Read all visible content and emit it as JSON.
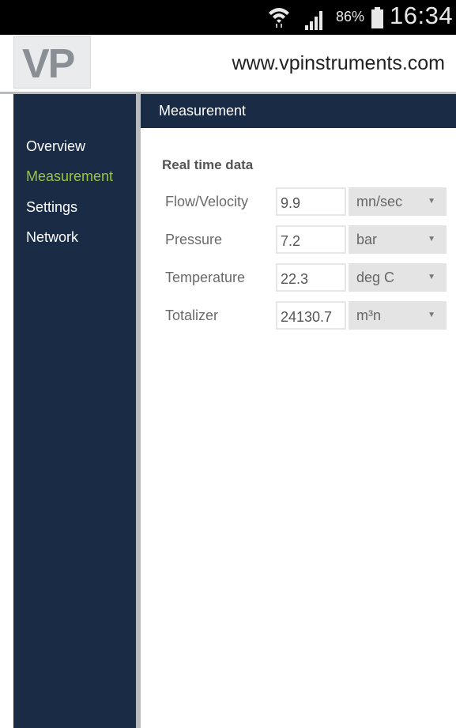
{
  "status_bar": {
    "battery_percent": "86%",
    "time": "16:34"
  },
  "header": {
    "logo_text": "VP",
    "site_url": "www.vpinstruments.com"
  },
  "sidebar": {
    "items": [
      {
        "label": "Overview"
      },
      {
        "label": "Measurement"
      },
      {
        "label": "Settings"
      },
      {
        "label": "Network"
      }
    ]
  },
  "main": {
    "page_title": "Measurement",
    "section_title": "Real time data",
    "rows": [
      {
        "label": "Flow/Velocity",
        "value": "9.9",
        "unit": "mn/sec"
      },
      {
        "label": "Pressure",
        "value": "7.2",
        "unit": "bar"
      },
      {
        "label": "Temperature",
        "value": "22.3",
        "unit": "deg C"
      },
      {
        "label": "Totalizer",
        "value": "24130.7",
        "unit": "m³n"
      }
    ]
  },
  "colors": {
    "nav_background": "#1a2b45",
    "active_item": "#9bc53d"
  },
  "icons": [
    "wifi-icon",
    "signal-icon",
    "battery-icon",
    "dropdown-caret-icon"
  ]
}
